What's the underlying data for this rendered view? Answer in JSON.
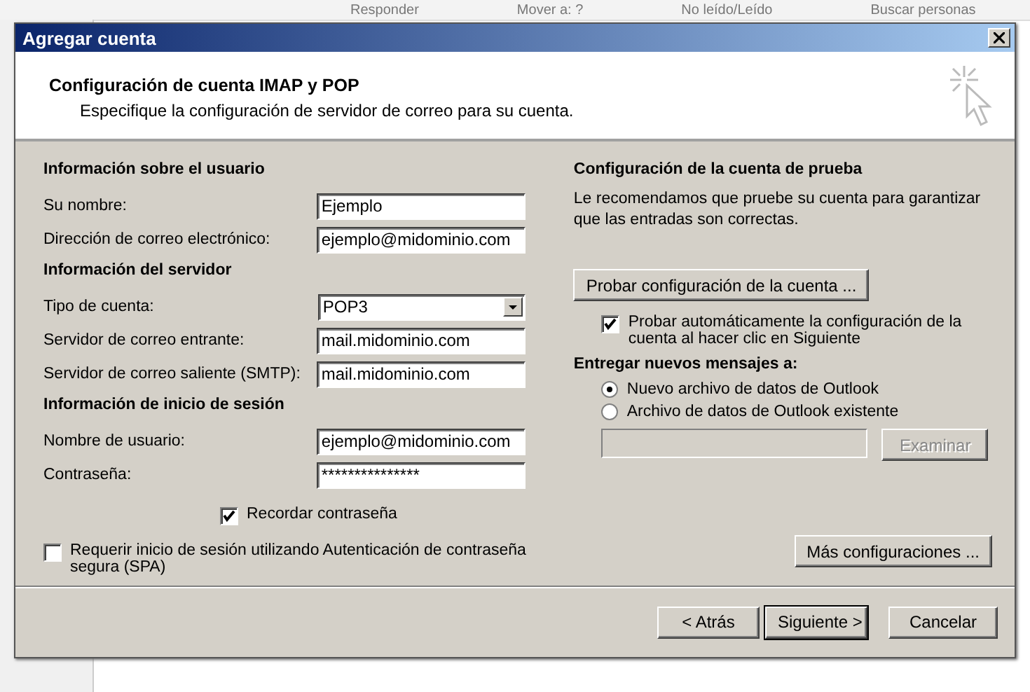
{
  "background": {
    "toolbar": [
      "Responder",
      "Mover a: ?",
      "No leído/Leído",
      "Buscar personas"
    ]
  },
  "window": {
    "title": "Agregar cuenta"
  },
  "header": {
    "title": "Configuración de cuenta IMAP y POP",
    "subtitle": "Especifique la configuración de servidor de correo para su cuenta."
  },
  "left": {
    "sections": [
      {
        "heading": "Información sobre el usuario",
        "fields": [
          {
            "label": "Su nombre:",
            "value": "Ejemplo",
            "kind": "text"
          },
          {
            "label": "Dirección de correo electrónico:",
            "value": "ejemplo@midominio.com",
            "kind": "text"
          }
        ]
      },
      {
        "heading": "Información del servidor",
        "fields": [
          {
            "label": "Tipo de cuenta:",
            "value": "POP3",
            "kind": "select"
          },
          {
            "label": "Servidor de correo entrante:",
            "value": "mail.midominio.com",
            "kind": "text"
          },
          {
            "label": "Servidor de correo saliente (SMTP):",
            "value": "mail.midominio.com",
            "kind": "text"
          }
        ]
      },
      {
        "heading": "Información de inicio de sesión",
        "fields": [
          {
            "label": "Nombre de usuario:",
            "value": "ejemplo@midominio.com",
            "kind": "text"
          },
          {
            "label": "Contraseña:",
            "value": "***************",
            "kind": "password"
          }
        ]
      }
    ],
    "remember": {
      "label": "Recordar contraseña",
      "checked": true
    },
    "spa": {
      "label": "Requerir inicio de sesión utilizando Autenticación de contraseña segura (SPA)",
      "checked": false
    }
  },
  "right": {
    "heading": "Configuración de la cuenta de prueba",
    "description": "Le recomendamos que pruebe su cuenta para garantizar que las entradas son correctas.",
    "test_button": "Probar configuración de la cuenta ...",
    "auto_test": {
      "label": "Probar automáticamente la configuración de la cuenta al hacer clic en Siguiente",
      "checked": true
    },
    "deliver_heading": "Entregar nuevos mensajes a:",
    "deliver_options": [
      {
        "label": "Nuevo archivo de datos de Outlook",
        "selected": true
      },
      {
        "label": "Archivo de datos de Outlook existente",
        "selected": false
      }
    ],
    "browse_button": {
      "label": "Examinar",
      "disabled": true
    },
    "more_button": "Más configuraciones ..."
  },
  "buttons": [
    {
      "label": "< Atrás",
      "default": false
    },
    {
      "label": "Siguiente >",
      "default": true
    },
    {
      "label": "Cancelar",
      "default": false
    }
  ]
}
